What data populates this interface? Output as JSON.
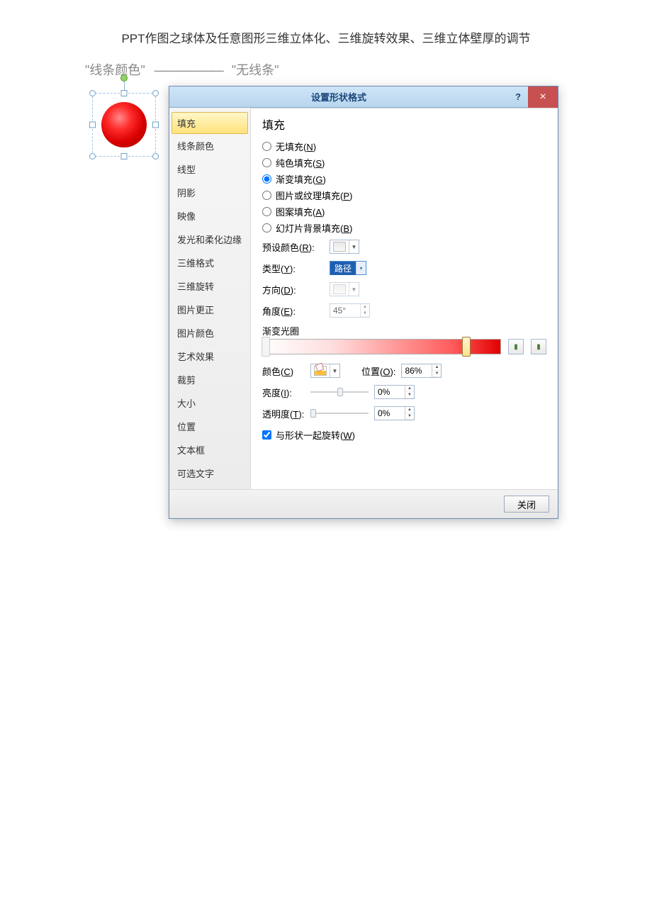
{
  "doc_title": "PPT作图之球体及任意图形三维立体化、三维旋转效果、三维立体壁厚的调节",
  "breadcrumb": {
    "a": "线条颜色",
    "sep": "——————",
    "b": "无线条"
  },
  "dialog_title": "设置形状格式",
  "help_symbol": "?",
  "close_symbol": "×",
  "sidebar": [
    "填充",
    "线条颜色",
    "线型",
    "阴影",
    "映像",
    "发光和柔化边缘",
    "三维格式",
    "三维旋转",
    "图片更正",
    "图片颜色",
    "艺术效果",
    "裁剪",
    "大小",
    "位置",
    "文本框",
    "可选文字"
  ],
  "selected_sidebar_index": 0,
  "panel_title": "填充",
  "fill_options": [
    {
      "label": "无填充",
      "hot": "N"
    },
    {
      "label": "纯色填充",
      "hot": "S"
    },
    {
      "label": "渐变填充",
      "hot": "G"
    },
    {
      "label": "图片或纹理填充",
      "hot": "P"
    },
    {
      "label": "图案填充",
      "hot": "A"
    },
    {
      "label": "幻灯片背景填充",
      "hot": "B"
    }
  ],
  "fill_selected_index": 2,
  "preset_label": "预设颜色",
  "preset_hot": "R",
  "type_label": "类型",
  "type_hot": "Y",
  "type_value": "路径",
  "direction_label": "方向",
  "direction_hot": "D",
  "angle_label": "角度",
  "angle_hot": "E",
  "angle_value": "45°",
  "gradstops_label": "渐变光圈",
  "color_label": "颜色",
  "color_hot": "C",
  "position_label": "位置",
  "position_hot": "O",
  "position_value": "86%",
  "brightness_label": "亮度",
  "brightness_hot": "I",
  "brightness_value": "0%",
  "transparency_label": "透明度",
  "transparency_hot": "T",
  "transparency_value": "0%",
  "rotate_label": "与形状一起旋转",
  "rotate_hot": "W",
  "rotate_checked": true,
  "close_button": "关闭"
}
